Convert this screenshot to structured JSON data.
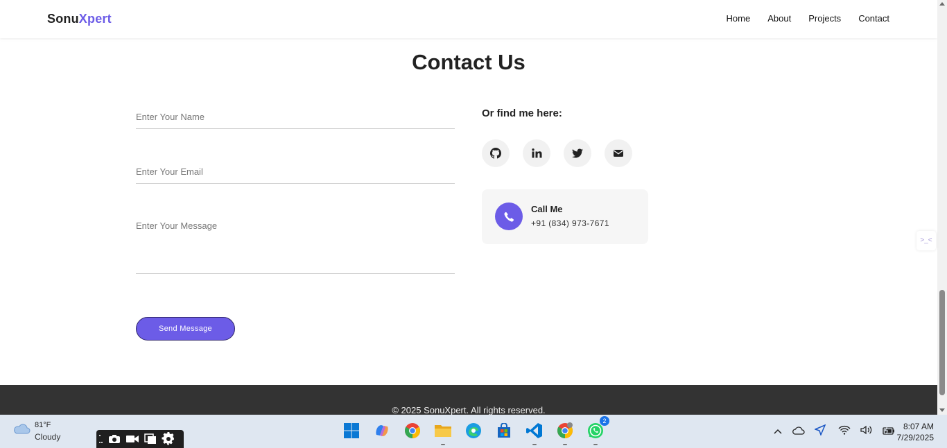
{
  "header": {
    "logo_part1": "Sonu",
    "logo_part2": "Xpert",
    "nav": [
      "Home",
      "About",
      "Projects",
      "Contact"
    ]
  },
  "contact": {
    "title": "Contact Us",
    "name_placeholder": "Enter Your Name",
    "email_placeholder": "Enter Your Email",
    "message_placeholder": "Enter Your Message",
    "send_label": "Send Message",
    "find_title": "Or find me here:",
    "socials": [
      "github-icon",
      "linkedin-icon",
      "twitter-icon",
      "mail-icon"
    ],
    "call_title": "Call Me",
    "call_phone": "+91 (834) 973-7671"
  },
  "footer": {
    "text": "© 2025 SonuXpert. All rights reserved."
  },
  "taskbar": {
    "temp": "81°F",
    "condition": "Cloudy",
    "whatsapp_badge": "2",
    "time": "8:07 AM",
    "date": "7/29/2025"
  },
  "colors": {
    "accent": "#6c5ce7",
    "footer_bg": "#333333",
    "taskbar_bg": "#dfe7f1"
  }
}
